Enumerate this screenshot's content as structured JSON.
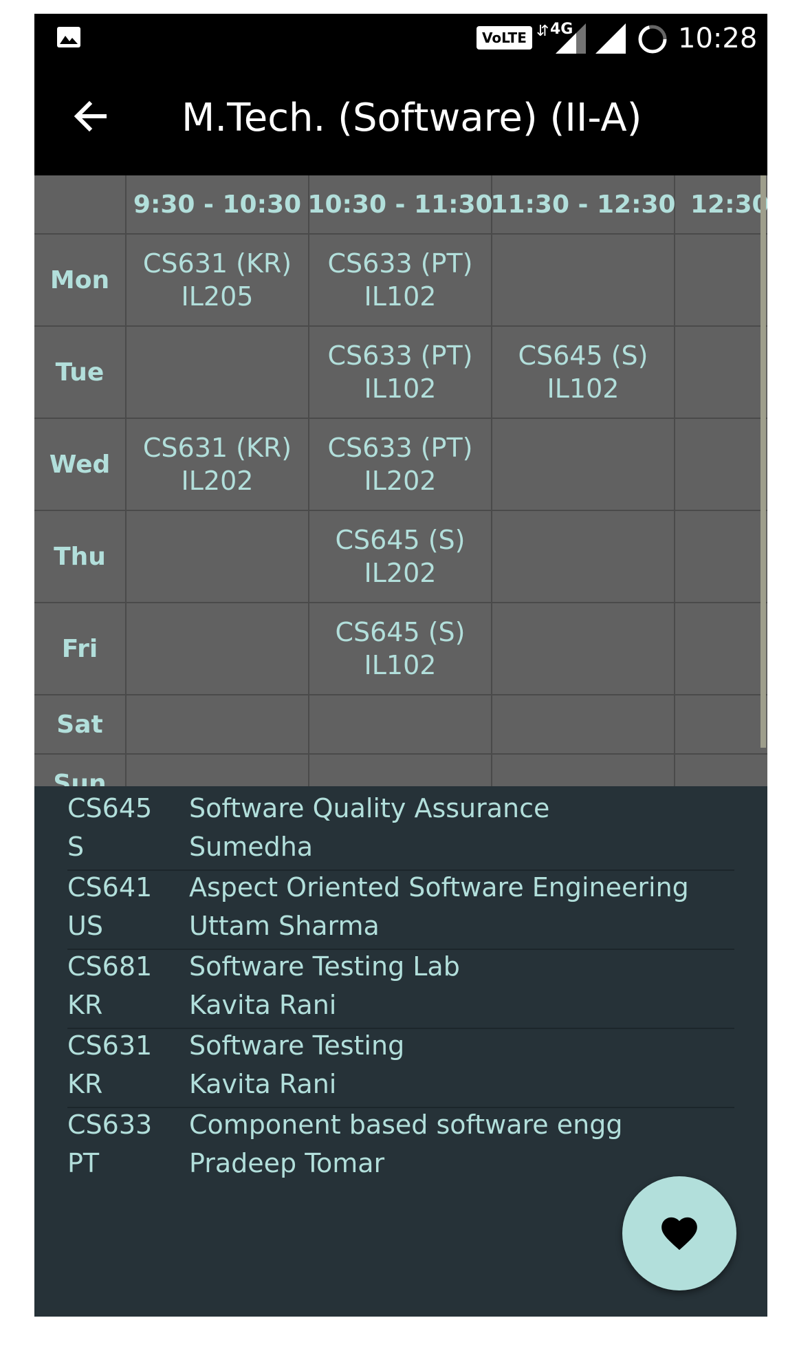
{
  "status_bar": {
    "volte": "VoLTE",
    "network": "4G",
    "time": "10:28"
  },
  "app_bar": {
    "title": "M.Tech. (Software) (II-A)",
    "back_icon": "arrow-back-icon"
  },
  "timetable": {
    "time_slots": [
      "9:30 - 10:30",
      "10:30 - 11:30",
      "11:30 - 12:30",
      "12:30"
    ],
    "rows": [
      {
        "day": "Mon",
        "cells": [
          [
            "CS631 (KR)",
            "IL205"
          ],
          [
            "CS633 (PT)",
            "IL102"
          ],
          [
            "",
            ""
          ],
          [
            "",
            ""
          ]
        ]
      },
      {
        "day": "Tue",
        "cells": [
          [
            "",
            ""
          ],
          [
            "CS633 (PT)",
            "IL102"
          ],
          [
            "CS645 (S)",
            "IL102"
          ],
          [
            "",
            ""
          ]
        ]
      },
      {
        "day": "Wed",
        "cells": [
          [
            "CS631 (KR)",
            "IL202"
          ],
          [
            "CS633 (PT)",
            "IL202"
          ],
          [
            "",
            ""
          ],
          [
            "",
            ""
          ]
        ]
      },
      {
        "day": "Thu",
        "cells": [
          [
            "",
            ""
          ],
          [
            "CS645 (S)",
            "IL202"
          ],
          [
            "",
            ""
          ],
          [
            "",
            ""
          ]
        ]
      },
      {
        "day": "Fri",
        "cells": [
          [
            "",
            ""
          ],
          [
            "CS645 (S)",
            "IL102"
          ],
          [
            "",
            ""
          ],
          [
            "",
            ""
          ]
        ]
      },
      {
        "day": "Sat",
        "cells": [
          [
            "",
            ""
          ],
          [
            "",
            ""
          ],
          [
            "",
            ""
          ],
          [
            "",
            ""
          ]
        ]
      },
      {
        "day": "Sun",
        "cells": [
          [
            "",
            ""
          ],
          [
            "",
            ""
          ],
          [
            "",
            ""
          ],
          [
            "",
            ""
          ]
        ]
      }
    ]
  },
  "courses": [
    {
      "code": "CS645",
      "name": "Software Quality Assurance",
      "abbr": "S",
      "teacher": "Sumedha"
    },
    {
      "code": "CS641",
      "name": "Aspect Oriented Software Engineering",
      "abbr": "US",
      "teacher": "Uttam Sharma"
    },
    {
      "code": "CS681",
      "name": "Software Testing Lab",
      "abbr": "KR",
      "teacher": "Kavita Rani"
    },
    {
      "code": "CS631",
      "name": "Software Testing",
      "abbr": "KR",
      "teacher": "Kavita Rani"
    },
    {
      "code": "CS633",
      "name": "Component based software engg",
      "abbr": "PT",
      "teacher": "Pradeep Tomar"
    }
  ],
  "fab": {
    "icon": "heart-icon"
  },
  "colors": {
    "accent": "#b2dfdb",
    "table_bg": "#616161",
    "list_bg": "#263238",
    "bar_bg": "#000000"
  }
}
